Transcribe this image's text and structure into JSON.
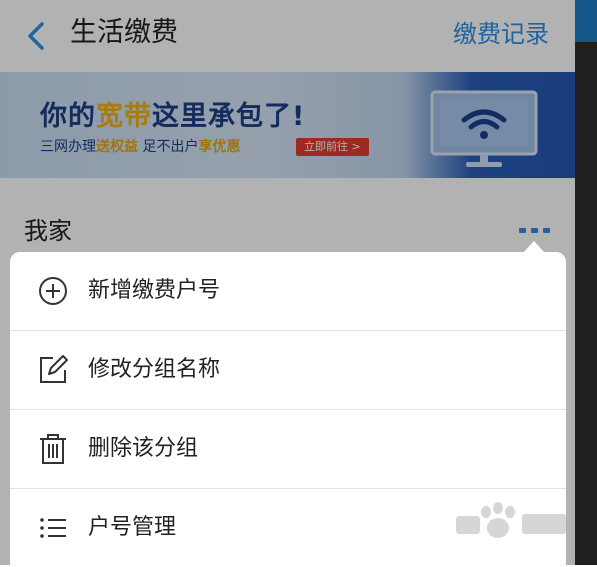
{
  "header": {
    "title": "生活缴费",
    "record_link": "缴费记录"
  },
  "banner": {
    "headline_prefix": "你的",
    "headline_highlight": "宽带",
    "headline_suffix": "这里承包了!",
    "sub_prefix": "三网办理",
    "sub_accent_1": "送权益",
    "sub_middle": "  足不出户",
    "sub_accent_2": "享优惠",
    "cta_label": "立即前往 >"
  },
  "group": {
    "name": "我家"
  },
  "menu": {
    "items": [
      {
        "label": "新增缴费户号",
        "icon": "plus-circle-icon"
      },
      {
        "label": "修改分组名称",
        "icon": "edit-icon"
      },
      {
        "label": "删除该分组",
        "icon": "trash-icon"
      },
      {
        "label": "户号管理",
        "icon": "list-icon"
      }
    ]
  },
  "watermark": {
    "text": "jingyan.baidu.com"
  },
  "colors": {
    "accent": "#2b8fe8",
    "banner_text": "#1d3f86",
    "banner_highlight": "#f2b21a",
    "cta": "#e23b32"
  }
}
